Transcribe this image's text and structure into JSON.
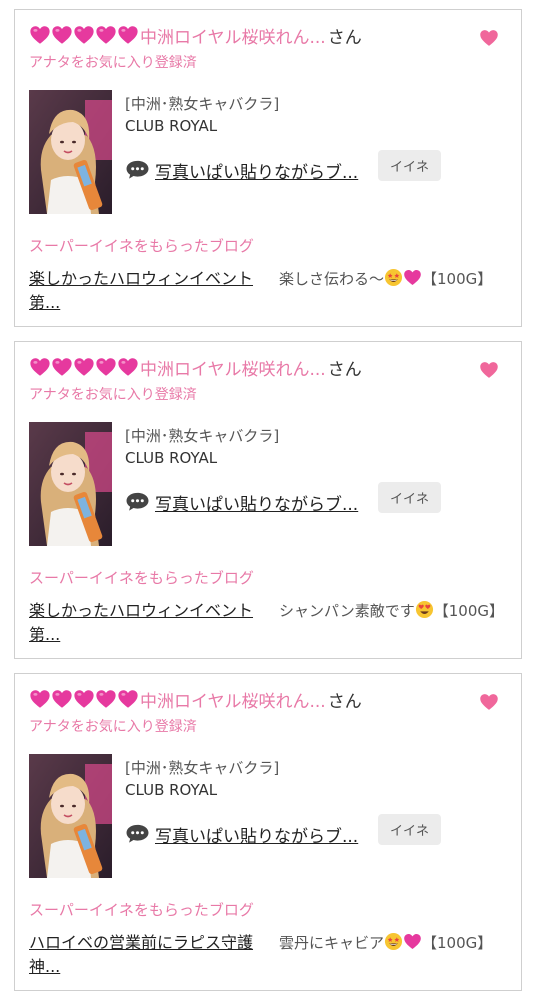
{
  "colors": {
    "pink": "#e879a7",
    "heart": "#f0679b",
    "magenta_heart": "#e6399e",
    "border": "#cfcfcf",
    "button_bg": "#ececec"
  },
  "cards": [
    {
      "user_name": "中洲ロイヤル桜咲れん...",
      "honorific": "さん",
      "favorite_status": "アナタをお気に入り登録済",
      "shop_type": "[中洲･熟女キャバクラ]",
      "shop_name": "CLUB ROYAL",
      "blog_title": "写真いぱい貼りながらブ...",
      "iine_label": "イイネ",
      "super_heading": "スーパーイイネをもらったブログ",
      "super_blog_title": "楽しかったハロウィンイベント第...",
      "super_comment_text": "楽しさ伝わる〜",
      "super_comment_emojis": [
        "star-struck-icon",
        "pink-heart-icon"
      ],
      "super_comment_reward": "【100G】"
    },
    {
      "user_name": "中洲ロイヤル桜咲れん...",
      "honorific": "さん",
      "favorite_status": "アナタをお気に入り登録済",
      "shop_type": "[中洲･熟女キャバクラ]",
      "shop_name": "CLUB ROYAL",
      "blog_title": "写真いぱい貼りながらブ...",
      "iine_label": "イイネ",
      "super_heading": "スーパーイイネをもらったブログ",
      "super_blog_title": "楽しかったハロウィンイベント第...",
      "super_comment_text": "シャンパン素敵です",
      "super_comment_emojis": [
        "heart-eyes-icon"
      ],
      "super_comment_reward": "【100G】"
    },
    {
      "user_name": "中洲ロイヤル桜咲れん...",
      "honorific": "さん",
      "favorite_status": "アナタをお気に入り登録済",
      "shop_type": "[中洲･熟女キャバクラ]",
      "shop_name": "CLUB ROYAL",
      "blog_title": "写真いぱい貼りながらブ...",
      "iine_label": "イイネ",
      "super_heading": "スーパーイイネをもらったブログ",
      "super_blog_title": "ハロイベの営業前にラピス守護神...",
      "super_comment_text": "雲丹にキャビア",
      "super_comment_emojis": [
        "star-struck-icon",
        "pink-heart-icon"
      ],
      "super_comment_reward": "【100G】"
    }
  ]
}
